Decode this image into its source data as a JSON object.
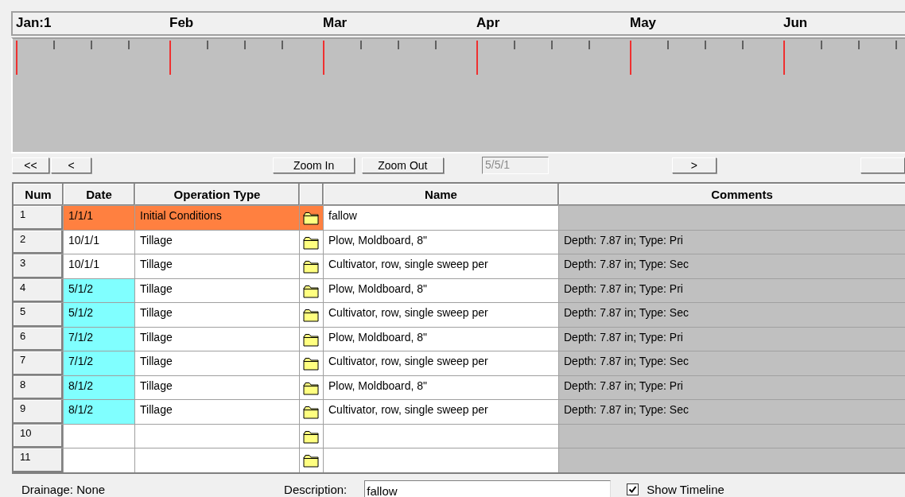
{
  "timeline": {
    "months": [
      "Jan:1",
      "Feb",
      "Mar",
      "Apr",
      "May",
      "Jun"
    ]
  },
  "toolbar": {
    "buttons_left": [
      "<<",
      "<"
    ],
    "zoom_buttons": [
      "Zoom In",
      "Zoom Out"
    ],
    "date_field": {
      "value": "5/5/1",
      "disabled": true
    },
    "next_button": ">"
  },
  "table": {
    "columns": [
      "Num",
      "Date",
      "Operation Type",
      "",
      "Name",
      "Comments"
    ],
    "rows": [
      {
        "num": "1",
        "date": "1/1/1",
        "type": "Initial Conditions",
        "name": "fallow",
        "comments": "",
        "color": "#ff8040",
        "whole": true
      },
      {
        "num": "2",
        "date": "10/1/1",
        "type": "Tillage",
        "name": "Plow, Moldboard, 8\"",
        "comments": "Depth: 7.87 in; Type: Pri"
      },
      {
        "num": "3",
        "date": "10/1/1",
        "type": "Tillage",
        "name": "Cultivator, row, single sweep per",
        "comments": "Depth: 7.87 in; Type: Sec"
      },
      {
        "num": "4",
        "date": "5/1/2",
        "type": "Tillage",
        "name": "Plow, Moldboard, 8\"",
        "comments": "Depth: 7.87 in; Type: Pri",
        "color": "#80ffff"
      },
      {
        "num": "5",
        "date": "5/1/2",
        "type": "Tillage",
        "name": "Cultivator, row, single sweep per",
        "comments": "Depth: 7.87 in; Type: Sec",
        "color": "#80ffff"
      },
      {
        "num": "6",
        "date": "7/1/2",
        "type": "Tillage",
        "name": "Plow, Moldboard, 8\"",
        "comments": "Depth: 7.87 in; Type: Pri",
        "color": "#80ffff"
      },
      {
        "num": "7",
        "date": "7/1/2",
        "type": "Tillage",
        "name": "Cultivator, row, single sweep per",
        "comments": "Depth: 7.87 in; Type: Sec",
        "color": "#80ffff"
      },
      {
        "num": "8",
        "date": "8/1/2",
        "type": "Tillage",
        "name": "Plow, Moldboard, 8\"",
        "comments": "Depth: 7.87 in; Type: Pri",
        "color": "#80ffff"
      },
      {
        "num": "9",
        "date": "8/1/2",
        "type": "Tillage",
        "name": "Cultivator, row, single sweep per",
        "comments": "Depth: 7.87 in; Type: Sec",
        "color": "#80ffff"
      },
      {
        "num": "10"
      },
      {
        "num": "11"
      }
    ]
  },
  "footer": {
    "drainage": "Drainage: None",
    "description_label": "Description:",
    "description": "fallow",
    "show_timeline": {
      "label": "Show Timeline",
      "checked": true
    }
  }
}
